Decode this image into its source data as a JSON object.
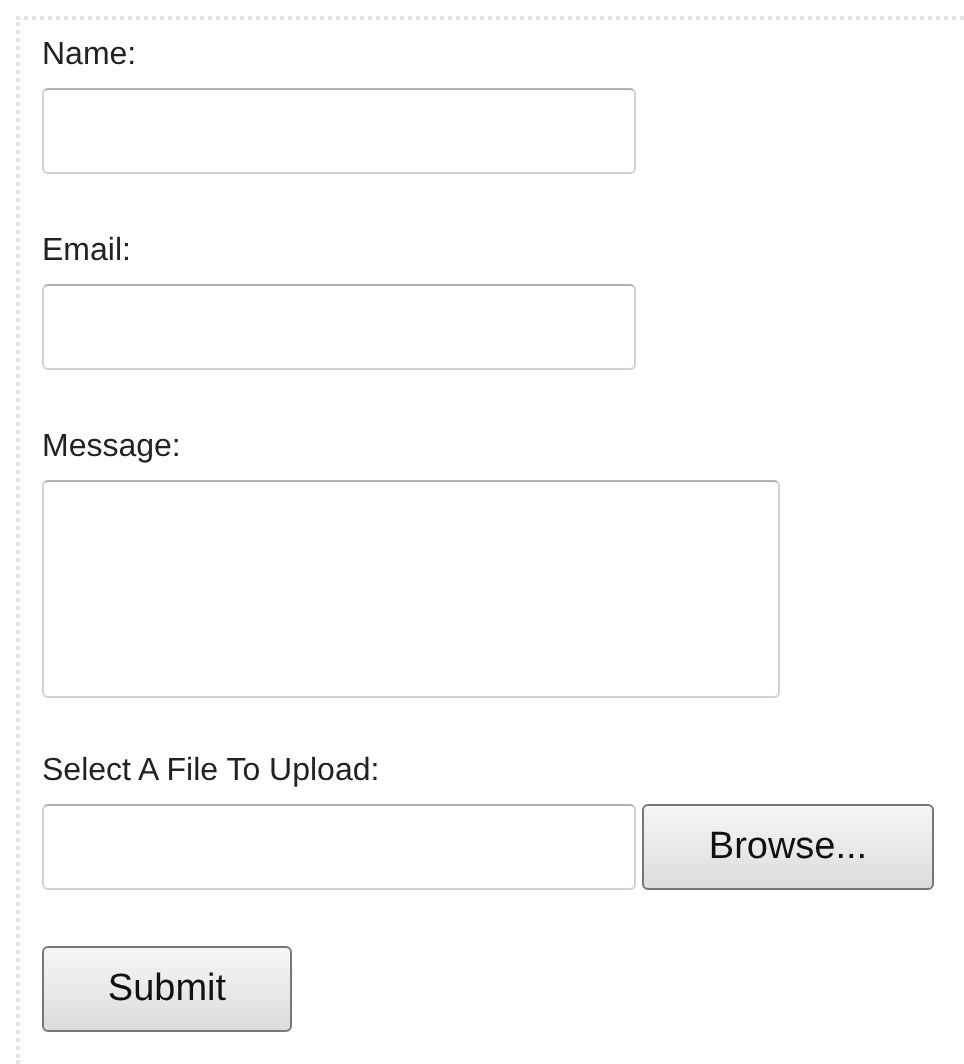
{
  "form": {
    "fields": [
      {
        "kind": "text",
        "label": "Name:"
      },
      {
        "kind": "text",
        "label": "Email:"
      },
      {
        "kind": "textarea",
        "label": "Message:"
      },
      {
        "kind": "file",
        "label": "Select A File To Upload:",
        "button": "Browse..."
      }
    ],
    "submit": "Submit"
  }
}
